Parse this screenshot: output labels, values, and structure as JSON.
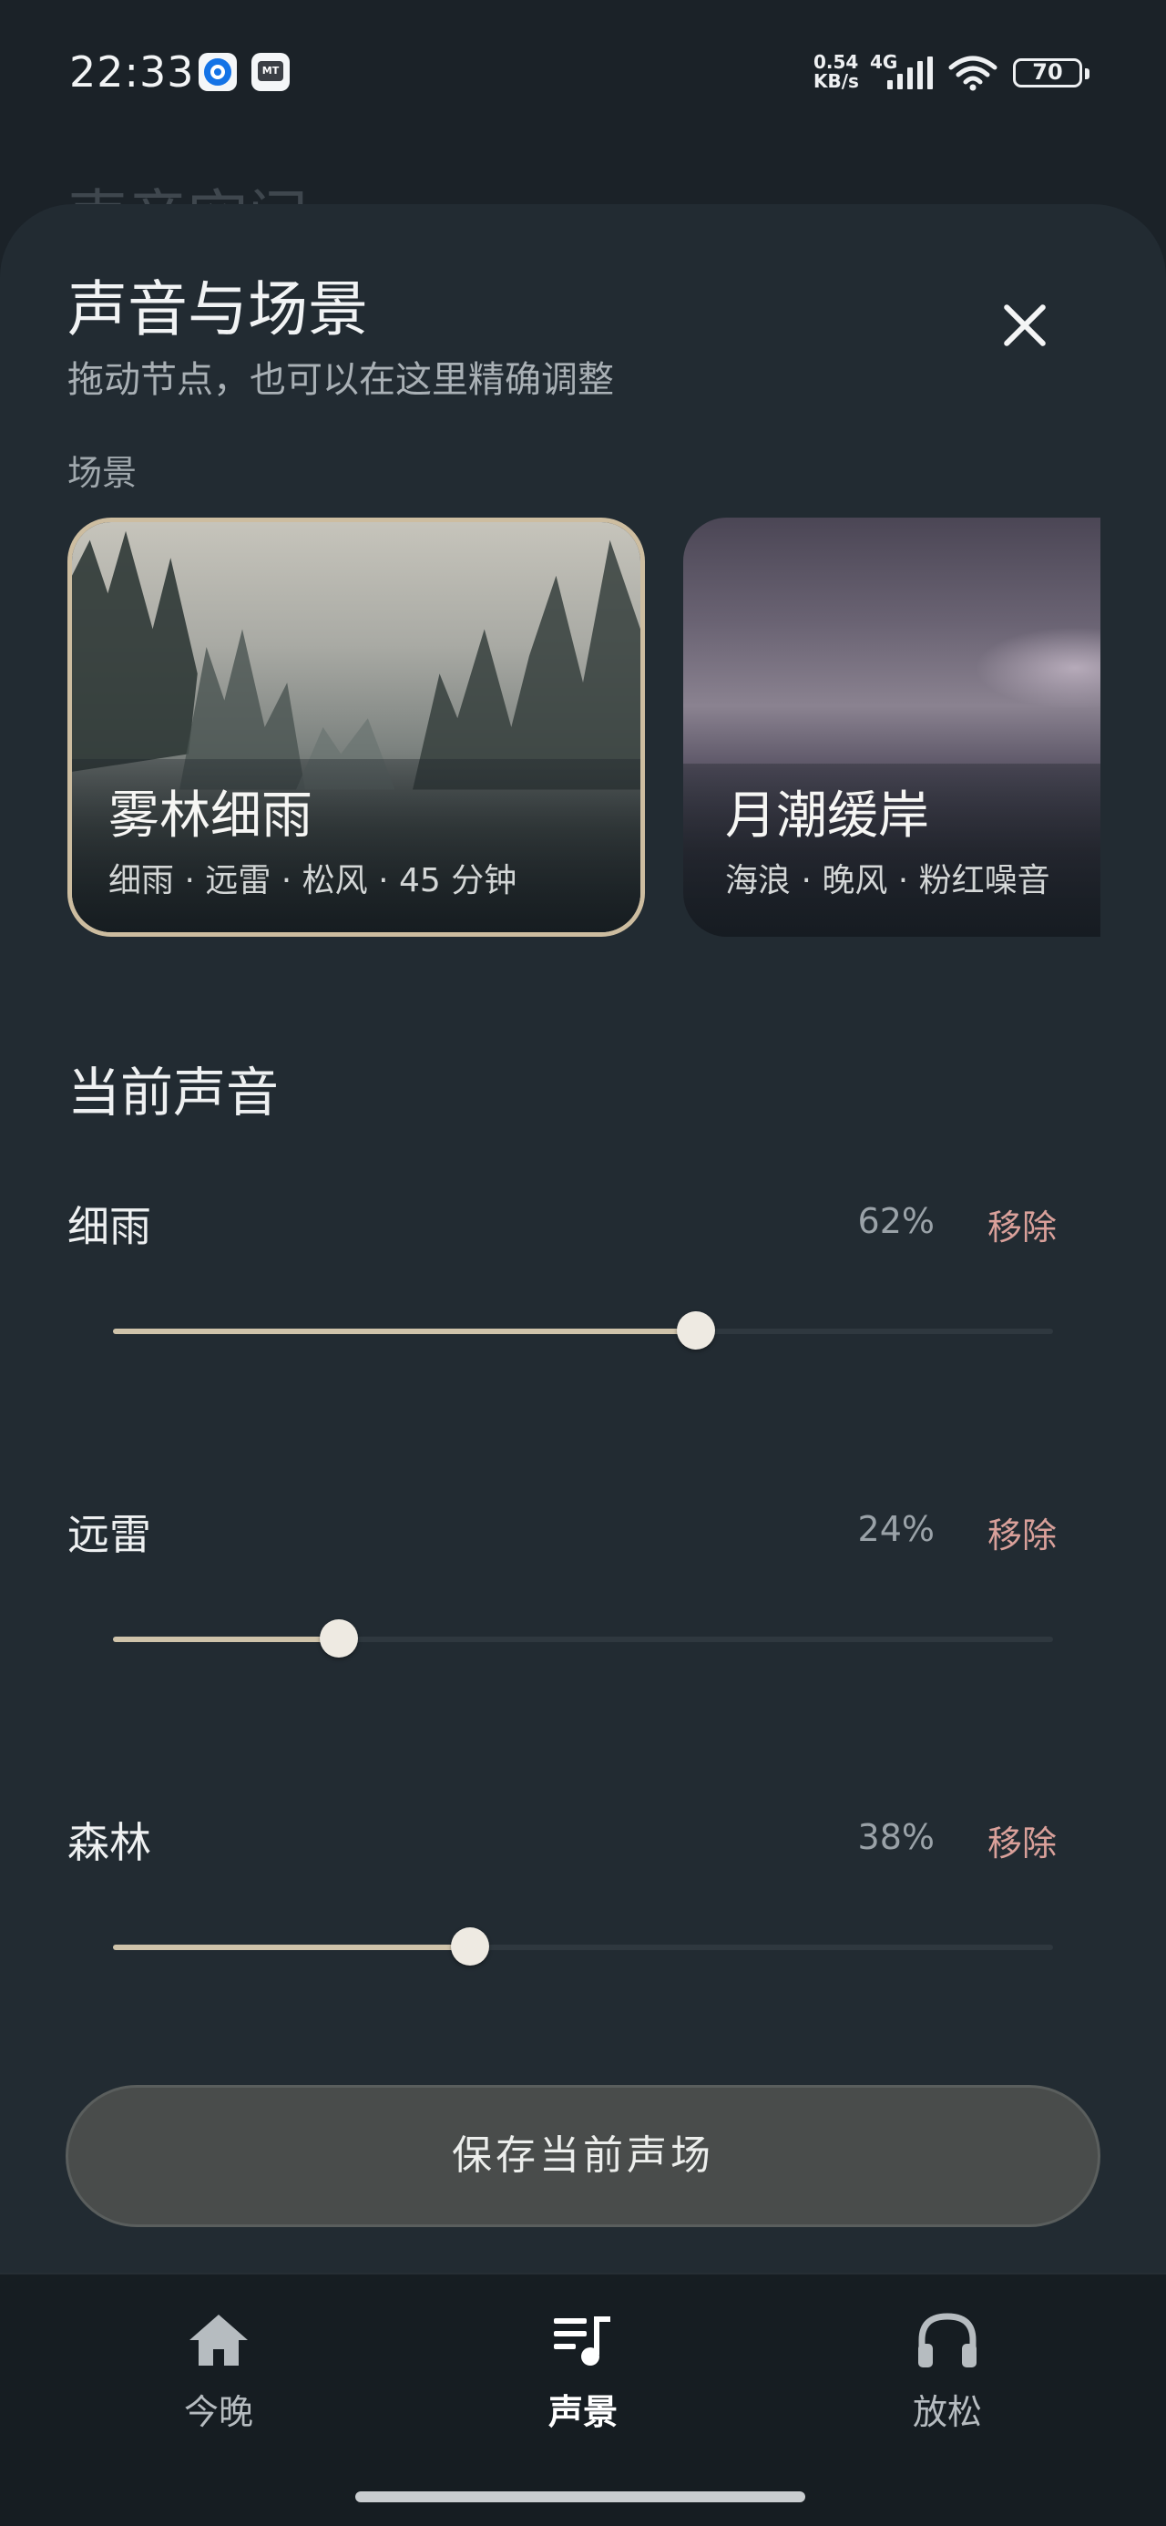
{
  "status_bar": {
    "time": "22:33",
    "net_speed_value": "0.54",
    "net_speed_unit": "KB/s",
    "network_type": "4G",
    "battery": "70"
  },
  "background_page": {
    "title": "声音空间"
  },
  "sheet": {
    "title": "声音与场景",
    "subtitle": "拖动节点，也可以在这里精确调整",
    "scenes_label": "场景",
    "scenes": [
      {
        "name": "雾林细雨",
        "tags": "细雨 · 远雷 · 松风 · 45 分钟",
        "selected": true
      },
      {
        "name": "月潮缓岸",
        "tags": "海浪 · 晚风 · 粉红噪音",
        "selected": false
      }
    ],
    "current_title": "当前声音",
    "sounds": [
      {
        "name": "细雨",
        "percent_label": "62%",
        "level": 0.62,
        "remove_label": "移除"
      },
      {
        "name": "远雷",
        "percent_label": "24%",
        "level": 0.24,
        "remove_label": "移除"
      },
      {
        "name": "森林",
        "percent_label": "38%",
        "level": 0.38,
        "remove_label": "移除"
      }
    ],
    "save_label": "保存当前声场"
  },
  "nav": {
    "items": [
      {
        "label": "今晚",
        "icon": "home-icon",
        "active": false
      },
      {
        "label": "声景",
        "icon": "playlist-music-icon",
        "active": true
      },
      {
        "label": "放松",
        "icon": "headphones-icon",
        "active": false
      }
    ]
  },
  "colors": {
    "accent": "#cfc3aa",
    "remove": "#d9a09a",
    "sheet_bg": "#222b32",
    "nav_bg": "#161d22"
  }
}
